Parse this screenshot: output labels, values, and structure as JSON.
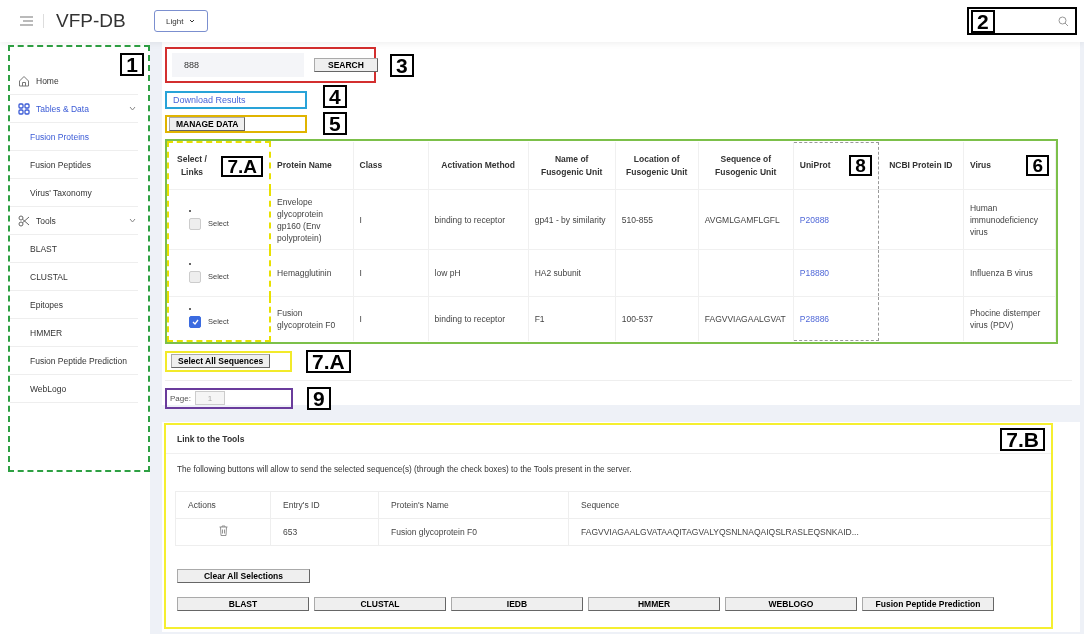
{
  "header": {
    "title": "VFP-DB",
    "theme_select": "Light",
    "search_callout": "2"
  },
  "sidebar": {
    "callout": "1",
    "items": [
      {
        "label": "Home",
        "selected": false
      },
      {
        "label": "Tables & Data",
        "selected": true,
        "expanded": true,
        "children": [
          {
            "label": "Fusion Proteins",
            "selected": true
          },
          {
            "label": "Fusion Peptides",
            "selected": false
          },
          {
            "label": "Virus' Taxonomy",
            "selected": false
          }
        ]
      },
      {
        "label": "Tools",
        "selected": false,
        "expanded": true,
        "children": [
          {
            "label": "BLAST",
            "selected": false
          },
          {
            "label": "CLUSTAL",
            "selected": false
          },
          {
            "label": "Epitopes",
            "selected": false
          },
          {
            "label": "HMMER",
            "selected": false
          },
          {
            "label": "Fusion Peptide Prediction",
            "selected": false
          },
          {
            "label": "WebLogo",
            "selected": false
          }
        ]
      }
    ]
  },
  "search": {
    "value": "888",
    "button": "SEARCH",
    "callout": "3"
  },
  "download": {
    "label": "Download Results",
    "callout": "4"
  },
  "manage": {
    "label": "MANAGE DATA",
    "callout": "5"
  },
  "results_table": {
    "callout": "6",
    "columns": [
      {
        "label": "Select / Links",
        "callout": "7.A"
      },
      {
        "label": "Protein Name"
      },
      {
        "label": "Class"
      },
      {
        "label": "Activation Method"
      },
      {
        "label": "Name of Fusogenic Unit"
      },
      {
        "label": "Location of Fusogenic Unit"
      },
      {
        "label": "Sequence of Fusogenic Unit"
      },
      {
        "label": "UniProt",
        "callout": "8"
      },
      {
        "label": "NCBI Protein ID"
      },
      {
        "label": "Virus"
      }
    ],
    "rows": [
      {
        "checked": false,
        "select_label": "Select",
        "protein_name": "Envelope glycoprotein gp160 (Env polyprotein)",
        "class": "I",
        "activation_method": "binding to receptor",
        "fusogenic_unit_name": "gp41 - by similarity",
        "fusogenic_unit_location": "510-855",
        "fusogenic_unit_sequence": "AVGMLGAMFLGFL",
        "uniprot": "P20888",
        "virus": "Human immunodeficiency virus"
      },
      {
        "checked": false,
        "select_label": "Select",
        "protein_name": "Hemagglutinin",
        "class": "I",
        "activation_method": "low pH",
        "fusogenic_unit_name": "HA2 subunit",
        "uniprot": "P18880",
        "virus": "Influenza B virus"
      },
      {
        "checked": true,
        "select_label": "Select",
        "protein_name": "Fusion glycoprotein F0",
        "class": "I",
        "activation_method": "binding to receptor",
        "fusogenic_unit_name": "F1",
        "fusogenic_unit_location": "100-537",
        "fusogenic_unit_sequence": "FAGVVIAGAALGVAT",
        "uniprot": "P28886",
        "virus": "Phocine distemper virus (PDV)"
      }
    ]
  },
  "select_all": {
    "label": "Select All Sequences",
    "callout": "7.A"
  },
  "pagination": {
    "label": "Page:",
    "value": "1",
    "callout": "9"
  },
  "tools_panel": {
    "title": "Link to the Tools",
    "callout": "7.B",
    "description": "The following buttons will allow to send the selected sequence(s) (through the check boxes) to the Tools present in the server.",
    "columns": [
      "Actions",
      "Entry's ID",
      "Protein's Name",
      "Sequence"
    ],
    "rows": [
      {
        "entry_id": "653",
        "protein_name": "Fusion glycoprotein F0",
        "sequence": "FAGVVIAGAALGVATAAQITAGVALYQSNLNAQAIQSLRASLEQSNKAID..."
      }
    ],
    "clear_button": "Clear All Selections",
    "tool_buttons": [
      "BLAST",
      "CLUSTAL",
      "IEDB",
      "HMMER",
      "WEBLOGO",
      "Fusion Peptide Prediction"
    ]
  }
}
